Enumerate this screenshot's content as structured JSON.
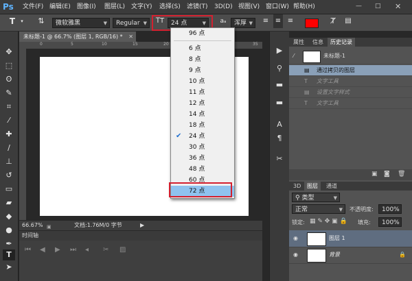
{
  "app": {
    "logo": "Ps"
  },
  "menu": [
    "文件(F)",
    "编辑(E)",
    "图像(I)",
    "图层(L)",
    "文字(Y)",
    "选择(S)",
    "滤镜(T)",
    "3D(D)",
    "视图(V)",
    "窗口(W)",
    "帮助(H)"
  ],
  "window_controls": {
    "min": "—",
    "max": "□",
    "close": "✕"
  },
  "options": {
    "font_family": "微软雅黑",
    "font_style": "Regular",
    "font_size": "24 点",
    "antialias": "浑厚",
    "text_color": "#ff0000"
  },
  "document": {
    "tab_title": "未标题-1 @ 66.7% (图层 1, RGB/16) *",
    "zoom": "66.67%",
    "doc_info": "文档:1.76M/0 字节",
    "ruler_marks": [
      "0",
      "5",
      "10",
      "15",
      "20",
      "25",
      "30",
      "35"
    ]
  },
  "timeline": {
    "title": "时间轴"
  },
  "size_dropdown": {
    "top_item": "96 点",
    "items": [
      "6 点",
      "8 点",
      "9 点",
      "10 点",
      "11 点",
      "12 点",
      "14 点",
      "18 点",
      "24 点",
      "30 点",
      "36 点",
      "48 点",
      "60 点",
      "72 点"
    ],
    "checked": "24 点",
    "highlighted": "72 点"
  },
  "history_panel": {
    "tabs": [
      "属性",
      "信息",
      "历史记录"
    ],
    "snapshot": "未标题-1",
    "rows": [
      "通过拷贝的图层",
      "文字工具",
      "设置文字样式",
      "文字工具"
    ]
  },
  "layers_panel": {
    "tabs": [
      "3D",
      "图层",
      "通道"
    ],
    "filter_label": "类型",
    "blend_mode": "正常",
    "opacity_label": "不透明度:",
    "opacity": "100%",
    "lock_label": "锁定:",
    "fill_label": "填充:",
    "fill": "100%",
    "layers": [
      {
        "name": "图层 1"
      },
      {
        "name": "背景"
      }
    ]
  }
}
